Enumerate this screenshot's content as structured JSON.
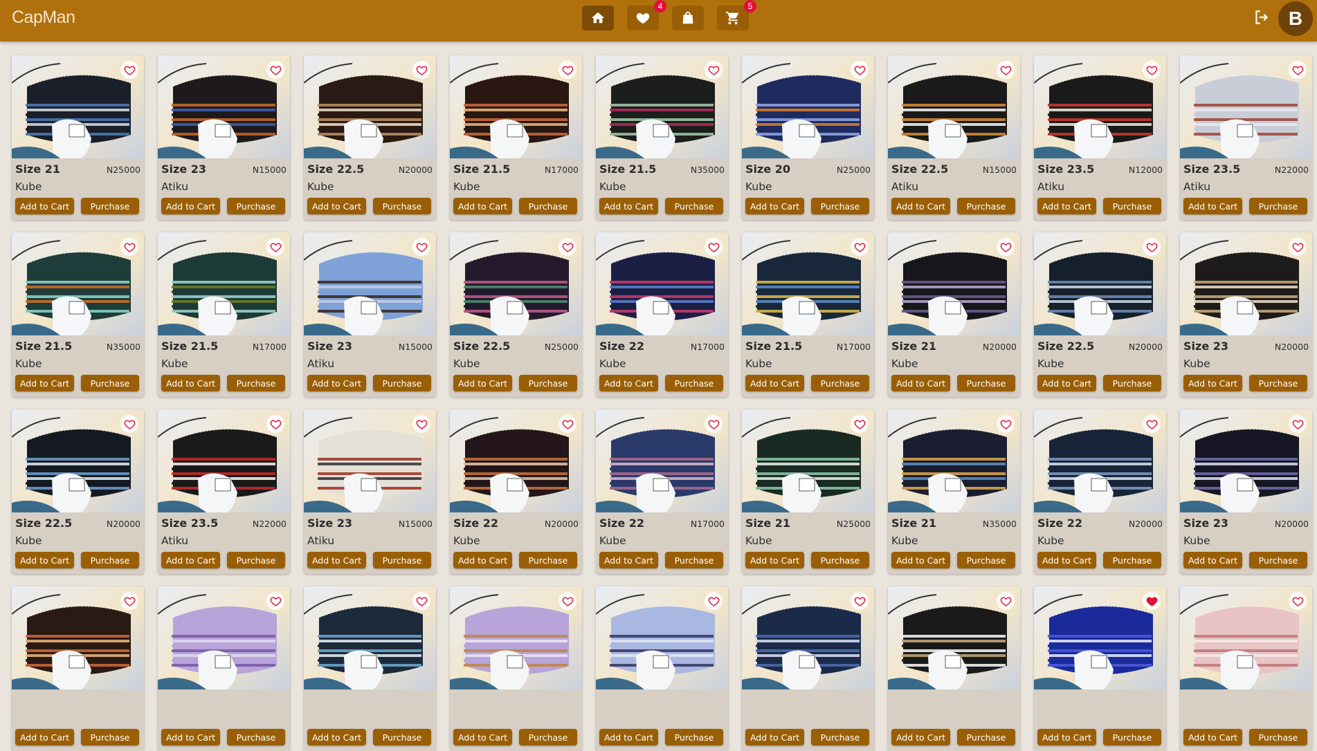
{
  "app": {
    "title": "CapMan",
    "user_initial": "B",
    "colors": {
      "header": "#b0700b",
      "button": "#9a5f06",
      "badge": "#e0103a",
      "card": "#d7cfc4",
      "background": "#e9e4dc"
    }
  },
  "nav": {
    "home_icon": "home-icon",
    "favorites_icon": "heart-icon",
    "favorites_count": "4",
    "orders_icon": "shopping-bag-icon",
    "cart_icon": "cart-icon",
    "cart_count": "5",
    "logout_icon": "logout-icon"
  },
  "labels": {
    "add_to_cart": "Add to Cart",
    "purchase": "Purchase"
  },
  "products": [
    {
      "size": "Size 21",
      "price": "N25000",
      "type": "Kube",
      "fav": false,
      "palette": [
        "#1b1f2a",
        "#4a78b0",
        "#cfd6de"
      ]
    },
    {
      "size": "Size 23",
      "price": "N15000",
      "type": "Atiku",
      "fav": false,
      "palette": [
        "#1e1a1c",
        "#c0662a",
        "#3a5fa8"
      ]
    },
    {
      "size": "Size 22.5",
      "price": "N20000",
      "type": "Kube",
      "fav": false,
      "palette": [
        "#2a1a14",
        "#b58b5f",
        "#e5d6c0"
      ]
    },
    {
      "size": "Size 21.5",
      "price": "N17000",
      "type": "Kube",
      "fav": false,
      "palette": [
        "#2a1712",
        "#c4663a",
        "#e3b07a"
      ]
    },
    {
      "size": "Size 21.5",
      "price": "N35000",
      "type": "Kube",
      "fav": false,
      "palette": [
        "#1c1e1c",
        "#9bc2a4",
        "#b02a5a"
      ]
    },
    {
      "size": "Size 20",
      "price": "N25000",
      "type": "Kube",
      "fav": false,
      "palette": [
        "#1f2b5e",
        "#8aa3e0",
        "#d47a2a"
      ]
    },
    {
      "size": "Size 22.5",
      "price": "N15000",
      "type": "Atiku",
      "fav": false,
      "palette": [
        "#1a1a1a",
        "#d38a32",
        "#f0f0f0"
      ]
    },
    {
      "size": "Size 23.5",
      "price": "N12000",
      "type": "Atiku",
      "fav": false,
      "palette": [
        "#1a1a1a",
        "#c43a2a",
        "#e9e2d8"
      ]
    },
    {
      "size": "Size 23.5",
      "price": "N22000",
      "type": "Atiku",
      "fav": false,
      "palette": [
        "#c9cdd8",
        "#a04a3a",
        "#e8e8ef"
      ]
    },
    {
      "size": "Size 21.5",
      "price": "N35000",
      "type": "Kube",
      "fav": false,
      "palette": [
        "#1e3c3a",
        "#8acfc0",
        "#c86a2a"
      ]
    },
    {
      "size": "Size 21.5",
      "price": "N17000",
      "type": "Kube",
      "fav": false,
      "palette": [
        "#1c3a36",
        "#9ad0c6",
        "#6a7a2a"
      ]
    },
    {
      "size": "Size 23",
      "price": "N15000",
      "type": "Atiku",
      "fav": false,
      "palette": [
        "#7ea2d8",
        "#3a2a22",
        "#c0cce8"
      ]
    },
    {
      "size": "Size 22.5",
      "price": "N25000",
      "type": "Kube",
      "fav": false,
      "palette": [
        "#241a2c",
        "#b85a8a",
        "#4a8a6a"
      ]
    },
    {
      "size": "Size 22",
      "price": "N17000",
      "type": "Kube",
      "fav": false,
      "palette": [
        "#1c1f44",
        "#c03a6a",
        "#5a7ac8"
      ]
    },
    {
      "size": "Size 21.5",
      "price": "N17000",
      "type": "Kube",
      "fav": false,
      "palette": [
        "#18283a",
        "#d6b64a",
        "#5a8ac0"
      ]
    },
    {
      "size": "Size 21",
      "price": "N20000",
      "type": "Kube",
      "fav": false,
      "palette": [
        "#17161c",
        "#6a5a8a",
        "#b0a4c8"
      ]
    },
    {
      "size": "Size 22.5",
      "price": "N20000",
      "type": "Kube",
      "fav": false,
      "palette": [
        "#16202c",
        "#6a8ab0",
        "#c8d4e4"
      ]
    },
    {
      "size": "Size 23",
      "price": "N20000",
      "type": "Kube",
      "fav": false,
      "palette": [
        "#1e1c1a",
        "#c0a47a",
        "#e4d8c4"
      ]
    },
    {
      "size": "Size 22.5",
      "price": "N20000",
      "type": "Kube",
      "fav": false,
      "palette": [
        "#151a22",
        "#6a9ac8",
        "#d8e4f0"
      ]
    },
    {
      "size": "Size 23.5",
      "price": "N22000",
      "type": "Atiku",
      "fav": false,
      "palette": [
        "#1a1a1a",
        "#c02a2a",
        "#f0ece4"
      ]
    },
    {
      "size": "Size 23",
      "price": "N15000",
      "type": "Atiku",
      "fav": false,
      "palette": [
        "#e4e0d8",
        "#a03a2a",
        "#3a3a3a"
      ]
    },
    {
      "size": "Size 22",
      "price": "N20000",
      "type": "Kube",
      "fav": false,
      "palette": [
        "#24161a",
        "#c0703a",
        "#e0c0a0"
      ]
    },
    {
      "size": "Size 22",
      "price": "N17000",
      "type": "Kube",
      "fav": false,
      "palette": [
        "#2a3a6a",
        "#a46a8a",
        "#d4b4c8"
      ]
    },
    {
      "size": "Size 21",
      "price": "N25000",
      "type": "Kube",
      "fav": false,
      "palette": [
        "#182a22",
        "#8ac0a4",
        "#e0e8e4"
      ]
    },
    {
      "size": "Size 21",
      "price": "N35000",
      "type": "Kube",
      "fav": false,
      "palette": [
        "#1a1e30",
        "#d8a24a",
        "#5a8ab8"
      ]
    },
    {
      "size": "Size 22",
      "price": "N20000",
      "type": "Kube",
      "fav": false,
      "palette": [
        "#182438",
        "#7a98c0",
        "#d0dcec"
      ]
    },
    {
      "size": "Size 23",
      "price": "N20000",
      "type": "Kube",
      "fav": false,
      "palette": [
        "#161624",
        "#6a6aa4",
        "#d8d8ec"
      ]
    },
    {
      "size": "",
      "price": "",
      "type": "",
      "fav": false,
      "palette": [
        "#2a1a14",
        "#c4663a",
        "#e3b07a"
      ]
    },
    {
      "size": "",
      "price": "",
      "type": "",
      "fav": false,
      "palette": [
        "#b8a4d8",
        "#7a5aa8",
        "#e0d8f0"
      ]
    },
    {
      "size": "",
      "price": "",
      "type": "",
      "fav": false,
      "palette": [
        "#1c2a3a",
        "#6aa4c8",
        "#e0e8f0"
      ]
    },
    {
      "size": "",
      "price": "",
      "type": "",
      "fav": false,
      "palette": [
        "#b8a4d8",
        "#c0864a",
        "#ece4f4"
      ]
    },
    {
      "size": "",
      "price": "",
      "type": "",
      "fav": false,
      "palette": [
        "#a8b8e0",
        "#3a3a6a",
        "#e0e4f4"
      ]
    },
    {
      "size": "",
      "price": "",
      "type": "",
      "fav": false,
      "palette": [
        "#1c2a4a",
        "#4a6aa8",
        "#d0d8ec"
      ]
    },
    {
      "size": "",
      "price": "",
      "type": "",
      "fav": false,
      "palette": [
        "#1a1a1a",
        "#f0f0f0",
        "#c0a47a"
      ]
    },
    {
      "size": "",
      "price": "",
      "type": "",
      "fav": true,
      "palette": [
        "#1a2a9a",
        "#4a5ad8",
        "#e0e4f8"
      ]
    },
    {
      "size": "",
      "price": "",
      "type": "",
      "fav": false,
      "palette": [
        "#e8c4c4",
        "#c07a7a",
        "#f4e8e8"
      ]
    }
  ]
}
